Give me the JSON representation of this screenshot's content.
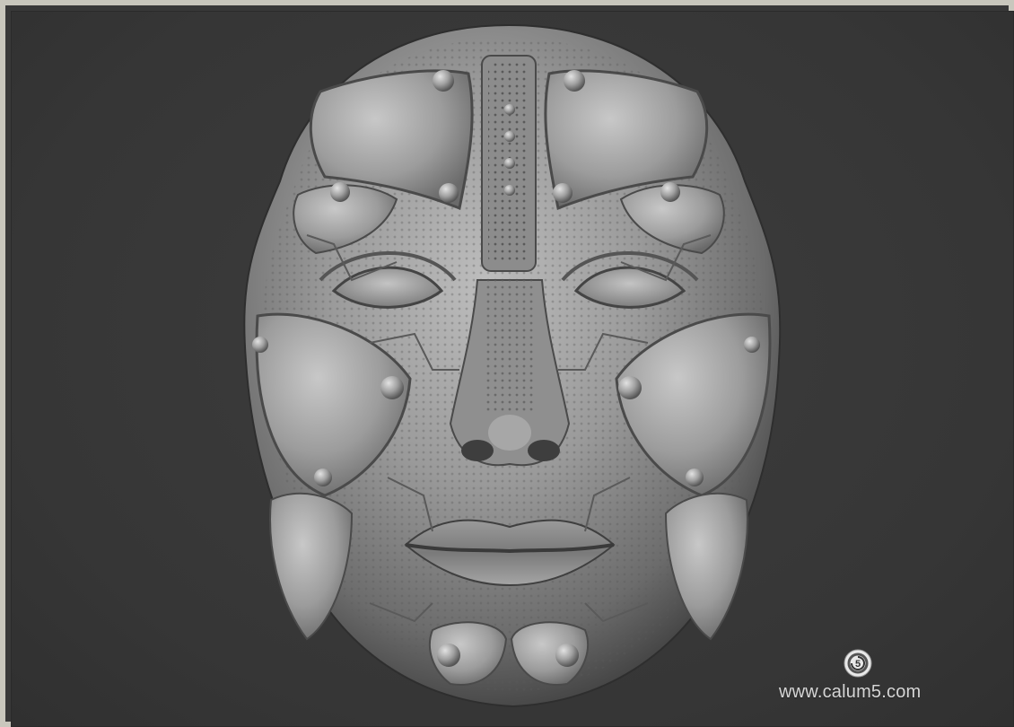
{
  "watermark": {
    "url_text": "www.calum5.com",
    "logo_icon": "calum5-logo-icon"
  },
  "colors": {
    "background": "#393939",
    "frame": "#c9c7bd",
    "sculpt_light": "#b9b9b9",
    "sculpt_mid": "#8a8a8a",
    "sculpt_dark": "#4a4a4a"
  }
}
